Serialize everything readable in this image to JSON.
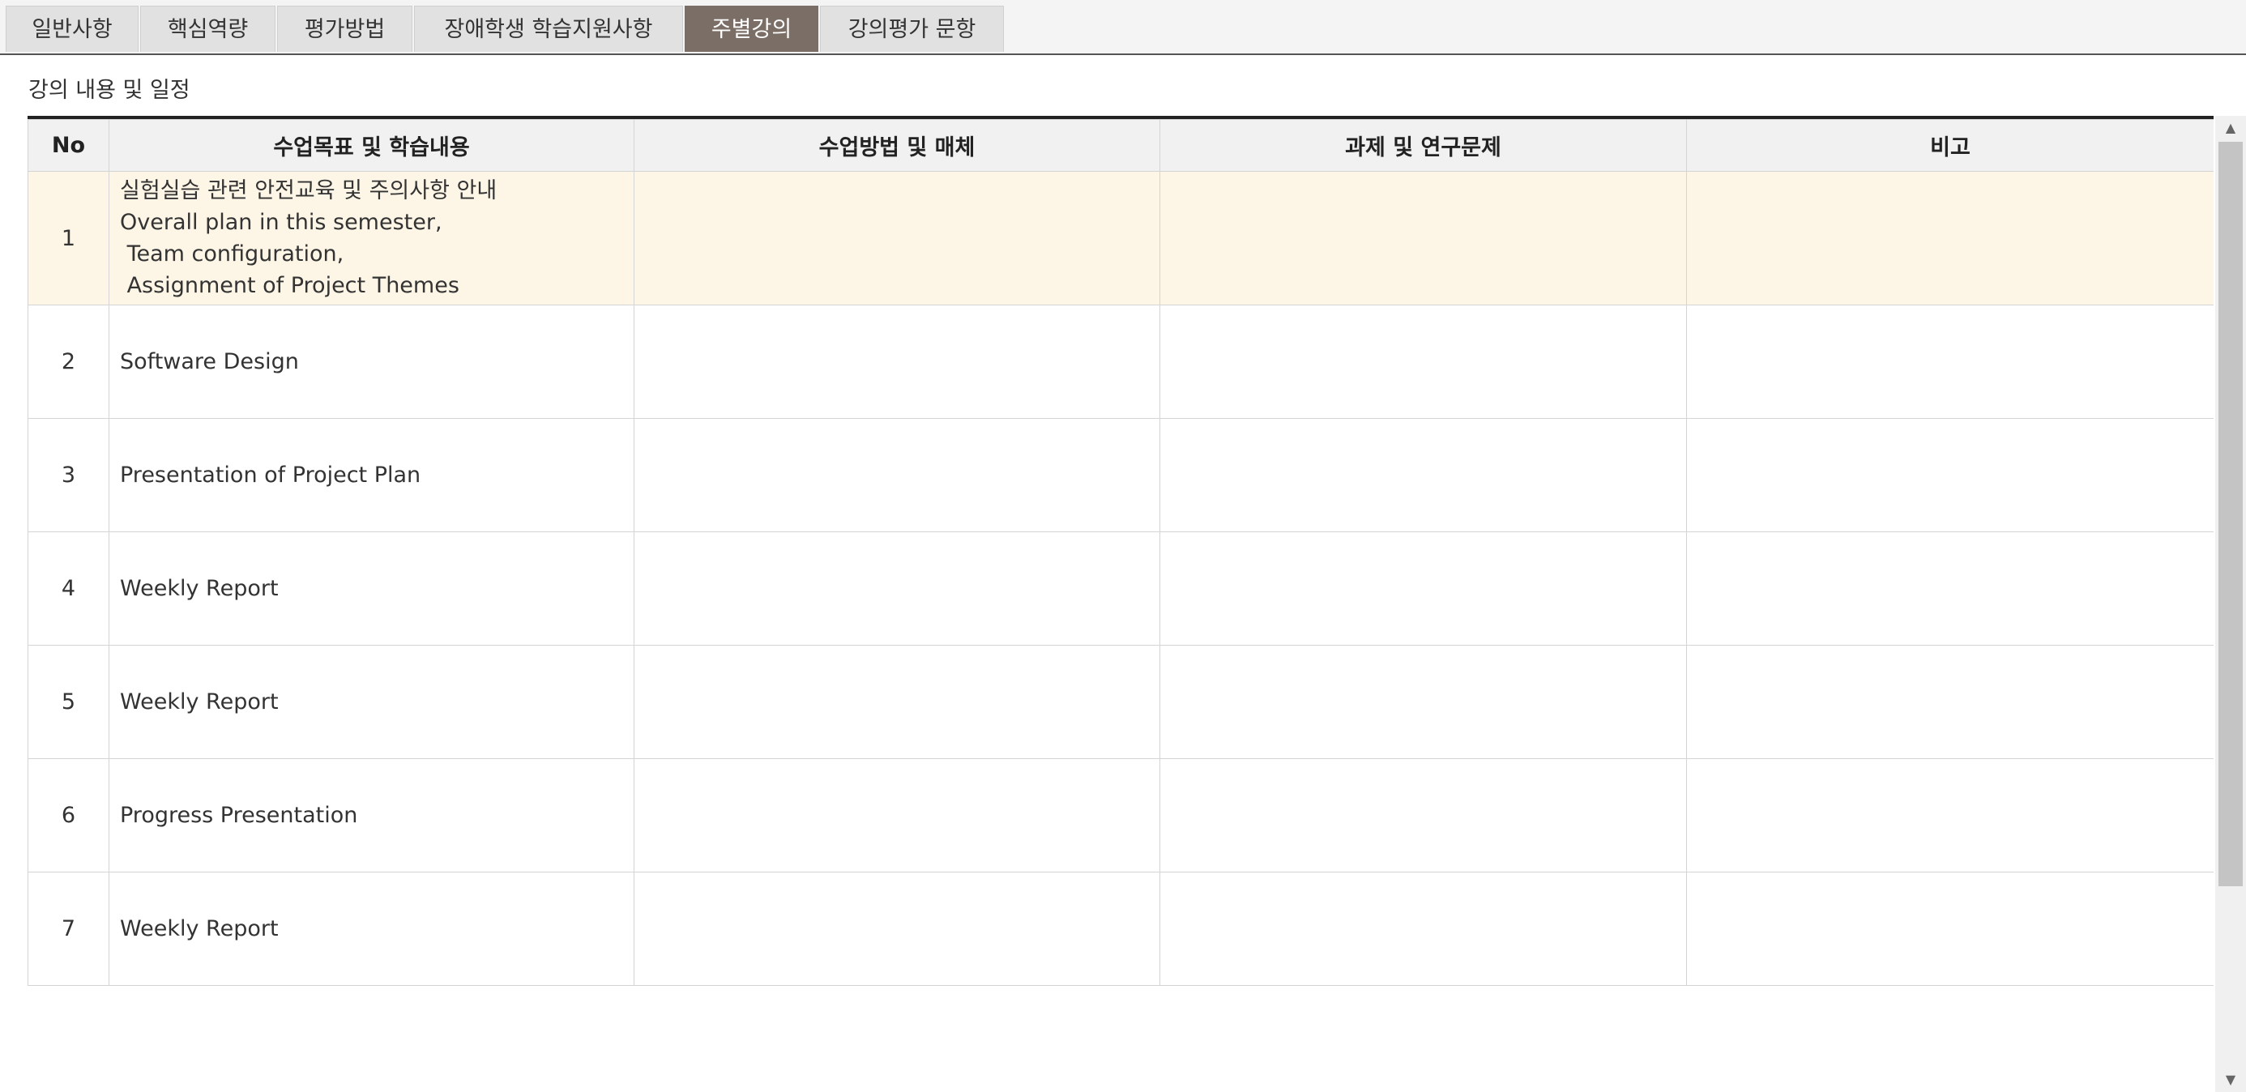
{
  "tabs": [
    {
      "label": "일반사항",
      "active": false
    },
    {
      "label": "핵심역량",
      "active": false
    },
    {
      "label": "평가방법",
      "active": false
    },
    {
      "label": "장애학생 학습지원사항",
      "active": false
    },
    {
      "label": "주별강의",
      "active": true
    },
    {
      "label": "강의평가 문항",
      "active": false
    }
  ],
  "section_title": "강의 내용 및 일정",
  "table": {
    "headers": [
      "No",
      "수업목표 및 학습내용",
      "수업방법 및 매체",
      "과제 및 연구문제",
      "비고"
    ],
    "rows": [
      {
        "no": "1",
        "content": "실험실습 관련 안전교육 및 주의사항 안내\nOverall plan in this semester,\n Team configuration,\n Assignment of Project Themes",
        "method": "",
        "assignment": "",
        "note": "",
        "highlighted": true
      },
      {
        "no": "2",
        "content": "Software Design",
        "method": "",
        "assignment": "",
        "note": ""
      },
      {
        "no": "3",
        "content": "Presentation of Project Plan",
        "method": "",
        "assignment": "",
        "note": ""
      },
      {
        "no": "4",
        "content": "Weekly Report",
        "method": "",
        "assignment": "",
        "note": ""
      },
      {
        "no": "5",
        "content": "Weekly Report",
        "method": "",
        "assignment": "",
        "note": ""
      },
      {
        "no": "6",
        "content": "Progress Presentation",
        "method": "",
        "assignment": "",
        "note": ""
      },
      {
        "no": "7",
        "content": "Weekly Report",
        "method": "",
        "assignment": "",
        "note": ""
      }
    ]
  },
  "scrollbar": {
    "up_icon": "triangle-up",
    "down_icon": "triangle-down"
  },
  "colors": {
    "active_tab": "#7a6e66",
    "highlight_row": "#fdf5e5",
    "header_bg": "#f1f1f1"
  }
}
